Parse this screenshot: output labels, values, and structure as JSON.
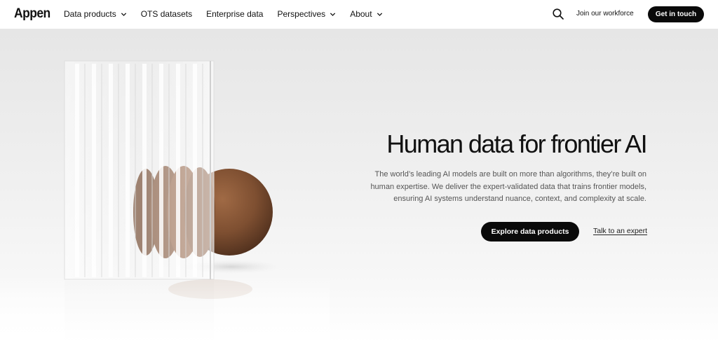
{
  "brand": {
    "logo": "Appen"
  },
  "nav": {
    "items": [
      {
        "label": "Data products",
        "has_dropdown": true
      },
      {
        "label": "OTS datasets",
        "has_dropdown": false
      },
      {
        "label": "Enterprise data",
        "has_dropdown": false
      },
      {
        "label": "Perspectives",
        "has_dropdown": true
      },
      {
        "label": "About",
        "has_dropdown": true
      }
    ],
    "search_icon": "search-icon",
    "join_label": "Join our workforce",
    "cta_label": "Get in touch"
  },
  "hero": {
    "title": "Human data for frontier AI",
    "description_lines": [
      "The world’s leading AI models are built on more than algorithms, they’re built on",
      "human expertise. We deliver the expert-validated data that trains frontier models,",
      "ensuring AI systems understand nuance, context, and complexity at scale."
    ],
    "primary_button": "Explore data products",
    "secondary_link": "Talk to an expert",
    "image_description_icon": "glass-sphere-illustration"
  },
  "colors": {
    "primary_button_bg": "#0a0a0a",
    "primary_button_text": "#ffffff",
    "text": "#111111",
    "muted_text": "#555555",
    "hero_bg_top": "#e6e6e6"
  }
}
